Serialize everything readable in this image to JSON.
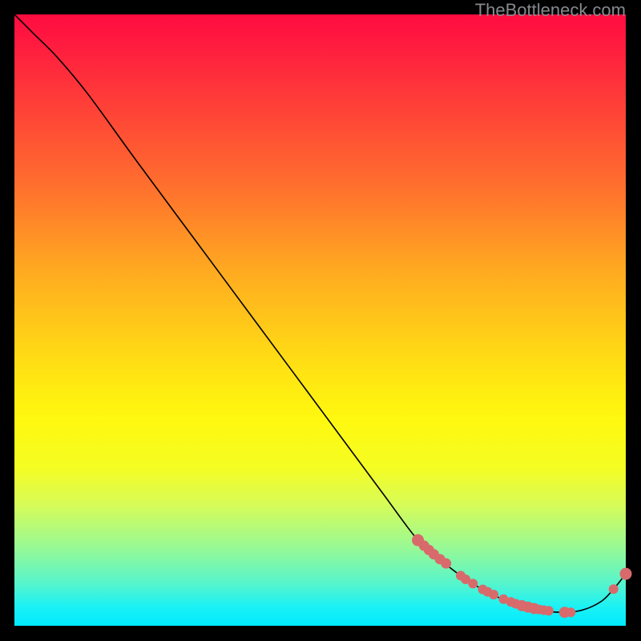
{
  "watermark": "TheBottleneck.com",
  "colors": {
    "background": "#000000",
    "dot": "#d86a6c",
    "curve": "#000000"
  },
  "chart_data": {
    "type": "line",
    "title": "",
    "xlabel": "",
    "ylabel": "",
    "xlim": [
      0,
      100
    ],
    "ylim": [
      0,
      100
    ],
    "curve": {
      "x": [
        0,
        3,
        7,
        12,
        20,
        30,
        40,
        50,
        60,
        66,
        70,
        74,
        78,
        82,
        86,
        90,
        93,
        96,
        98,
        100
      ],
      "y": [
        100,
        97,
        93,
        87,
        76,
        62.5,
        49,
        35.5,
        22,
        14,
        10.5,
        7.5,
        5.2,
        3.5,
        2.5,
        2.2,
        2.6,
        4.0,
        6.0,
        8.5
      ]
    },
    "series": [
      {
        "name": "points",
        "x": [
          66.0,
          67.0,
          67.8,
          68.6,
          69.6,
          70.6,
          73.0,
          73.8,
          75.0,
          76.6,
          77.4,
          78.4,
          80.0,
          81.2,
          82.0,
          83.0,
          84.0,
          85.0,
          85.8,
          86.6,
          87.4,
          90.0,
          91.0,
          98.0,
          100.0
        ],
        "y": [
          14.0,
          13.1,
          12.4,
          11.7,
          10.9,
          10.2,
          8.2,
          7.6,
          6.9,
          5.95,
          5.55,
          5.1,
          4.35,
          3.9,
          3.6,
          3.3,
          3.05,
          2.82,
          2.67,
          2.55,
          2.46,
          2.2,
          2.2,
          6.0,
          8.5
        ],
        "r": [
          7.5,
          6.5,
          6.5,
          6.5,
          6.5,
          6.5,
          6.0,
          6.0,
          6.0,
          6.0,
          6.0,
          6.0,
          6.0,
          6.0,
          6.0,
          7.0,
          7.0,
          7.0,
          6.0,
          6.0,
          6.0,
          7.0,
          6.0,
          6.0,
          7.5
        ]
      }
    ]
  }
}
